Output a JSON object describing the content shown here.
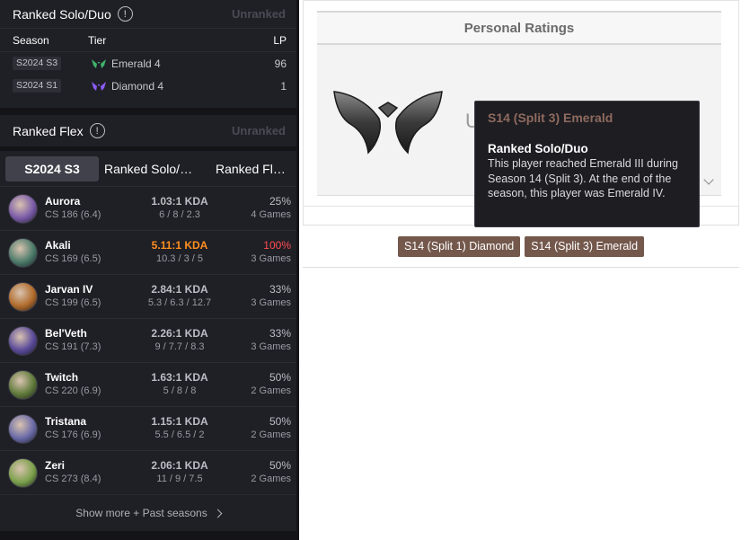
{
  "ranked_solo": {
    "title": "Ranked Solo/Duo",
    "status": "Unranked",
    "columns": {
      "season": "Season",
      "tier": "Tier",
      "lp": "LP"
    },
    "rows": [
      {
        "season": "S2024 S3",
        "tier": "Emerald 4",
        "lp": "96",
        "tier_color": "#3fb36b"
      },
      {
        "season": "S2024 S1",
        "tier": "Diamond 4",
        "lp": "1",
        "tier_color": "#8b5cf6"
      }
    ]
  },
  "ranked_flex": {
    "title": "Ranked Flex",
    "status": "Unranked"
  },
  "tabs": [
    {
      "label": "S2024 S3",
      "active": true
    },
    {
      "label": "Ranked Solo/Duo",
      "active": false
    },
    {
      "label": "Ranked Flex",
      "active": false
    }
  ],
  "champions": [
    {
      "name": "Aurora",
      "cs": "CS 186 (6.4)",
      "kda": "1.03:1 KDA",
      "stats": "6 / 8 / 2.3",
      "winrate": "25%",
      "games": "4 Games",
      "color": "#7a5aa8"
    },
    {
      "name": "Akali",
      "cs": "CS 169 (6.5)",
      "kda": "5.11:1 KDA",
      "stats": "10.3 / 3 / 5",
      "winrate": "100%",
      "games": "3 Games",
      "color": "#4b7a6a"
    },
    {
      "name": "Jarvan IV",
      "cs": "CS 199 (6.5)",
      "kda": "2.84:1 KDA",
      "stats": "5.3 / 6.3 / 12.7",
      "winrate": "33%",
      "games": "3 Games",
      "color": "#b06a2a"
    },
    {
      "name": "Bel'Veth",
      "cs": "CS 191 (7.3)",
      "kda": "2.26:1 KDA",
      "stats": "9 / 7.7 / 8.3",
      "winrate": "33%",
      "games": "3 Games",
      "color": "#5a4a9a"
    },
    {
      "name": "Twitch",
      "cs": "CS 220 (6.9)",
      "kda": "1.63:1 KDA",
      "stats": "5 / 8 / 8",
      "winrate": "50%",
      "games": "2 Games",
      "color": "#5f7a3a"
    },
    {
      "name": "Tristana",
      "cs": "CS 176 (6.9)",
      "kda": "1.15:1 KDA",
      "stats": "5.5 / 6.5 / 2",
      "winrate": "50%",
      "games": "2 Games",
      "color": "#6a6aa8"
    },
    {
      "name": "Zeri",
      "cs": "CS 273 (8.4)",
      "kda": "2.06:1 KDA",
      "stats": "11 / 9 / 7.5",
      "winrate": "50%",
      "games": "2 Games",
      "color": "#7aa04a"
    }
  ],
  "show_more": "Show more + Past seasons",
  "personal_ratings": {
    "title": "Personal Ratings",
    "partial_text": "U",
    "badges": [
      "S14 (Split 1) Diamond",
      "S14 (Split 3) Emerald"
    ]
  },
  "tooltip": {
    "title": "S14 (Split 3) Emerald",
    "subtitle": "Ranked Solo/Duo",
    "body": "This player reached Emerald III during Season 14 (Split 3). At the end of the season, this player was Emerald IV."
  },
  "colors": {
    "panel_dark": "#1f1f26",
    "kda_highlight": "#ff8f1f",
    "winrate_highlight": "#ff4e50",
    "badge_brown": "#74584c"
  }
}
